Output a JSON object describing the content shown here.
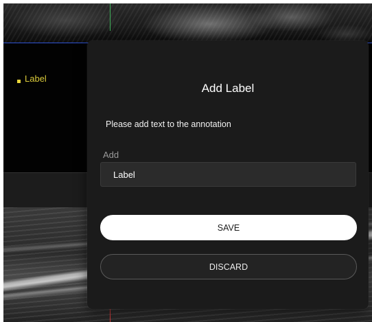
{
  "image_labels": {
    "marker_text": "Label"
  },
  "dialog": {
    "title": "Add Label",
    "subtitle": "Please add text to the annotation",
    "field_label": "Add",
    "field_value": "Label",
    "save_label": "SAVE",
    "discard_label": "DISCARD"
  },
  "colors": {
    "dialog_bg": "#1b1b1b",
    "marker": "#e8d53a",
    "crosshair_horizontal": "#2f54d6",
    "crosshair_vertical_top": "#3fb25a",
    "crosshair_vertical_bottom": "#d23a3a",
    "save_button_bg": "#ffffff"
  }
}
